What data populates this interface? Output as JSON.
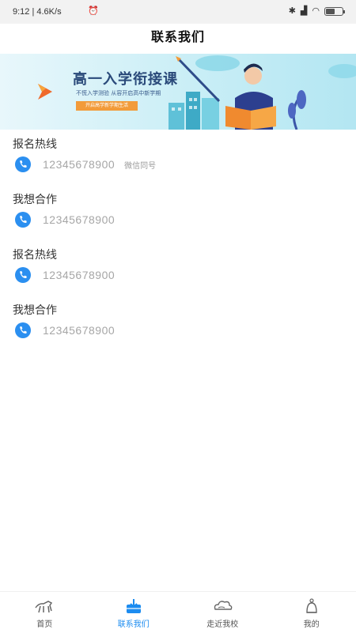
{
  "status_bar": {
    "left_text": "9:12 | 4.6K/s",
    "alarm_icon": "alarm-icon",
    "icons": [
      "bluetooth-icon",
      "signal-icon",
      "wifi-icon",
      "battery-icon"
    ],
    "battery_level": 0.55
  },
  "header": {
    "title": "联系我们"
  },
  "banner": {
    "title": "高一入学衔接课",
    "subtitle": "不慌入学测验 从容开启高中新学期",
    "button_label": "开启高学新学期生活"
  },
  "sections": [
    {
      "title": "报名热线",
      "phone": "12345678900",
      "note": "微信同号"
    },
    {
      "title": "我想合作",
      "phone": "12345678900",
      "note": ""
    },
    {
      "title": "报名热线",
      "phone": "12345678900",
      "note": ""
    },
    {
      "title": "我想合作",
      "phone": "12345678900",
      "note": ""
    }
  ],
  "nav": {
    "items": [
      {
        "label": "首页",
        "icon": "horse-icon",
        "active": false
      },
      {
        "label": "联系我们",
        "icon": "contact-inbox-icon",
        "active": true
      },
      {
        "label": "走近我校",
        "icon": "cloud-icon",
        "active": false
      },
      {
        "label": "我的",
        "icon": "profile-icon",
        "active": false
      }
    ]
  },
  "colors": {
    "accent": "#1c8cf0",
    "banner_button": "#f29b3a"
  }
}
